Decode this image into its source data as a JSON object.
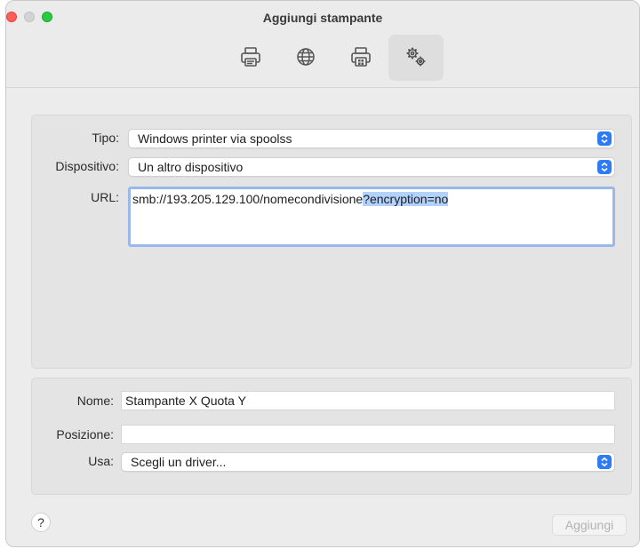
{
  "window": {
    "title": "Aggiungi stampante",
    "toolbar": [
      {
        "icon": "printer-icon"
      },
      {
        "icon": "globe-icon"
      },
      {
        "icon": "windows-printer-icon"
      },
      {
        "icon": "advanced-gears-icon",
        "active": true
      }
    ]
  },
  "top_panel": {
    "type_label": "Tipo:",
    "type_value": "Windows printer via spoolss",
    "device_label": "Dispositivo:",
    "device_value": "Un altro dispositivo",
    "url_label": "URL:",
    "url_value_plain": "smb://193.205.129.100/nomecondivisione",
    "url_value_selected": "?encryption=no"
  },
  "bottom_panel": {
    "name_label": "Nome:",
    "name_value": "Stampante X Quota Y",
    "location_label": "Posizione:",
    "location_value": "",
    "use_label": "Usa:",
    "use_value": "Scegli un driver..."
  },
  "footer": {
    "help_label": "?",
    "add_label": "Aggiungi"
  },
  "colors": {
    "accent": "#2d7cf6",
    "selection": "#b2d1fb",
    "focus_ring": "#9ab8e9"
  }
}
